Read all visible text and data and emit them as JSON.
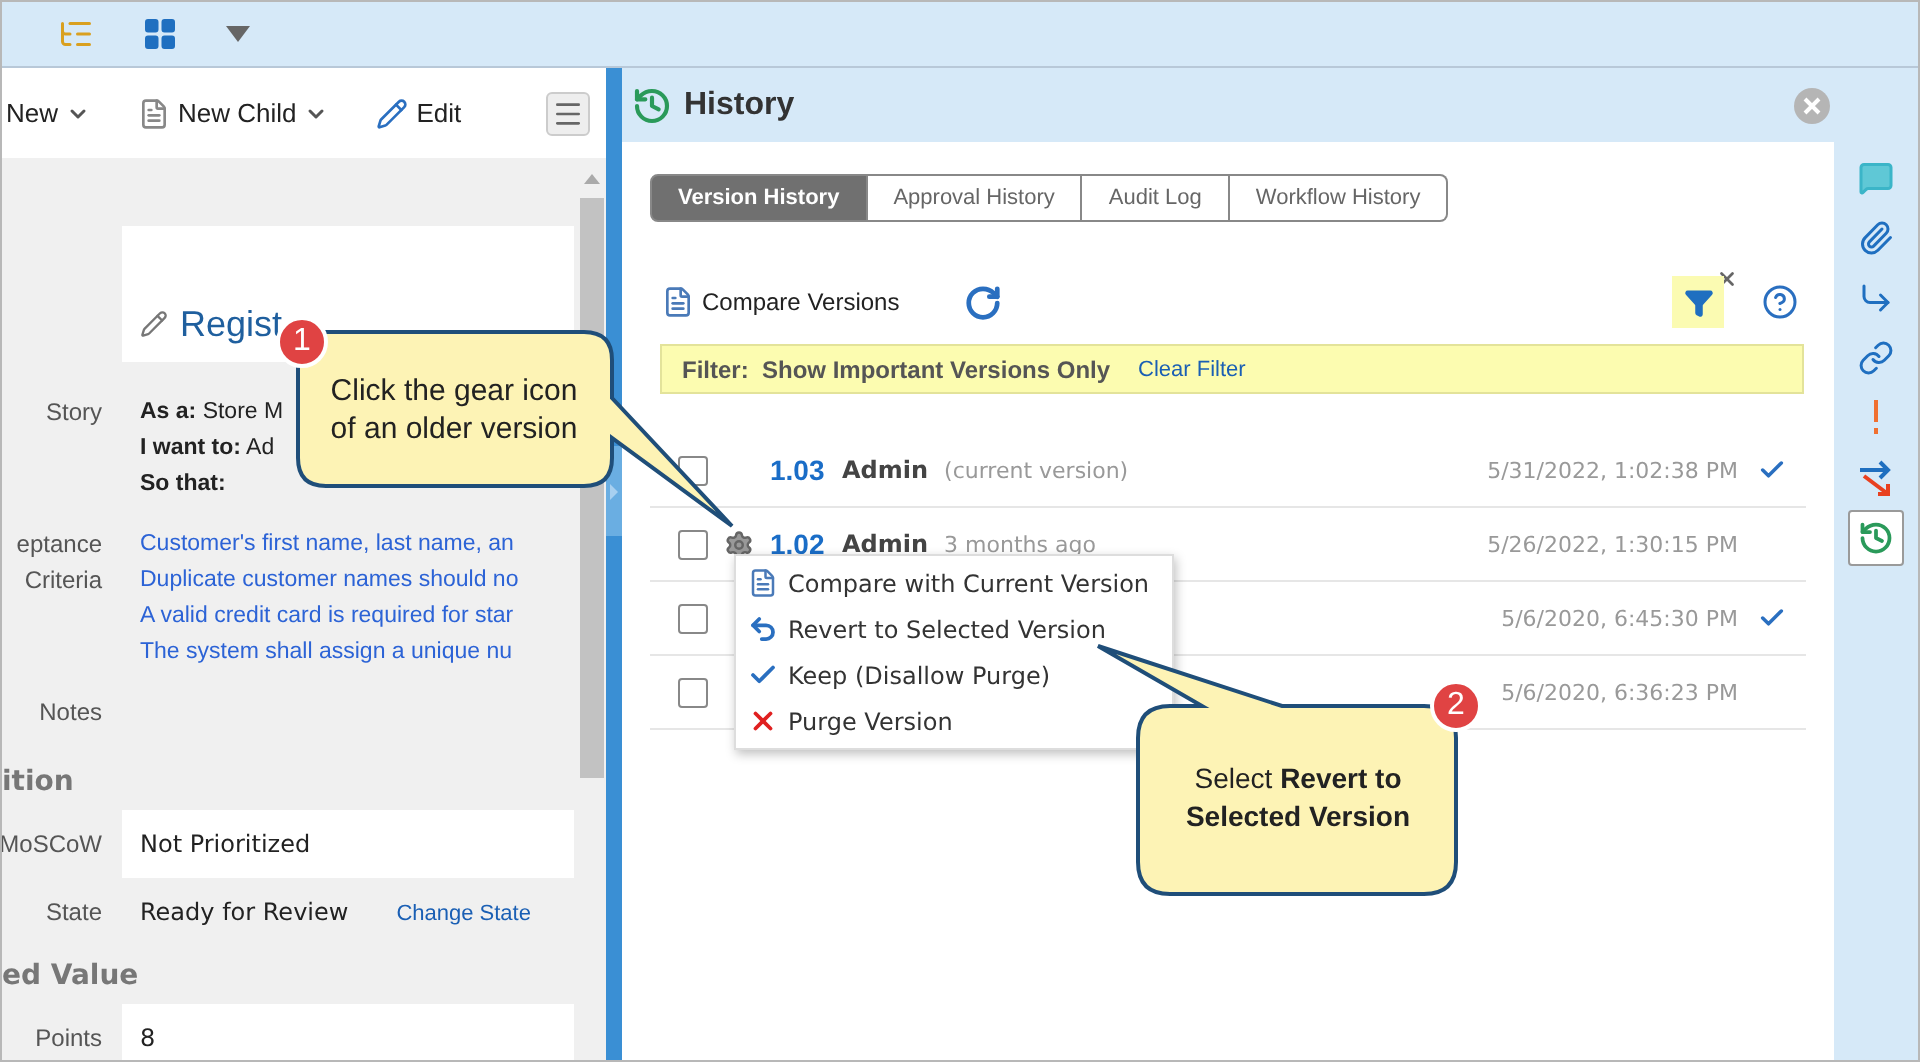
{
  "toolbar": {
    "buttons": [
      {
        "kind": "new",
        "label": "New"
      },
      {
        "kind": "new-child",
        "label": "New Child"
      },
      {
        "kind": "edit",
        "label": "Edit"
      }
    ]
  },
  "details": {
    "title": "Regist",
    "story_label": "Story",
    "story_lines": [
      "**As a:** Store M",
      "**I want to:** Ad",
      "**So that:**"
    ],
    "criteria_label": "eptance\nCriteria",
    "criteria": [
      "Customer's first name, last name, an",
      "Duplicate customer names should no",
      "A valid credit card is required for star",
      "The system shall assign a unique nu"
    ],
    "notes_label": "Notes",
    "groups": [
      {
        "heading": "ition",
        "fields": [
          {
            "label": "MoSCoW",
            "value": "Not Prioritized"
          },
          {
            "label": "State",
            "value": "Ready for Review",
            "link": "Change State"
          }
        ]
      },
      {
        "heading": "ed Value",
        "fields": [
          {
            "label": "Points",
            "value": "8"
          }
        ]
      }
    ]
  },
  "history": {
    "title": "History",
    "tabs": [
      {
        "label": "Version History",
        "selected": true
      },
      {
        "label": "Approval History",
        "selected": false
      },
      {
        "label": "Audit Log",
        "selected": false
      },
      {
        "label": "Workflow History",
        "selected": false
      }
    ],
    "compare_label": "Compare Versions",
    "filter_on": true,
    "filter": {
      "label": "Filter:",
      "value": "Show Important Versions Only",
      "clear": "Clear Filter"
    },
    "versions": [
      {
        "checked": false,
        "gear": false,
        "version": "1.03",
        "author": "Admin",
        "note": "(current version)",
        "date": "5/31/2022, 1:02:38 PM",
        "kept": true
      },
      {
        "checked": false,
        "gear": true,
        "version": "1.02",
        "author": "Admin",
        "note": "3 months ago",
        "date": "5/26/2022, 1:30:15 PM",
        "kept": false
      },
      {
        "checked": false,
        "gear": false,
        "date": "5/6/2020, 6:45:30 PM",
        "kept": true
      },
      {
        "checked": false,
        "gear": false,
        "date": "5/6/2020, 6:36:23 PM",
        "kept": false
      }
    ],
    "menu": [
      {
        "kind": "compare",
        "label": "Compare with Current Version"
      },
      {
        "kind": "revert",
        "label": "Revert to Selected Version"
      },
      {
        "kind": "keep",
        "label": "Keep (Disallow Purge)"
      },
      {
        "kind": "purge",
        "label": "Purge Version"
      }
    ]
  },
  "sidebar": {
    "items": [
      {
        "kind": "comment",
        "selected": false
      },
      {
        "kind": "attachment",
        "selected": false
      },
      {
        "kind": "trace",
        "selected": false
      },
      {
        "kind": "link",
        "selected": false
      },
      {
        "kind": "risk",
        "selected": false
      },
      {
        "kind": "relations",
        "selected": false
      },
      {
        "kind": "history",
        "selected": true
      }
    ]
  },
  "callouts": [
    {
      "number": "1",
      "text": "Click the gear icon\nof an older version"
    },
    {
      "number": "2",
      "text": "Select **Revert to Selected Version**"
    }
  ]
}
